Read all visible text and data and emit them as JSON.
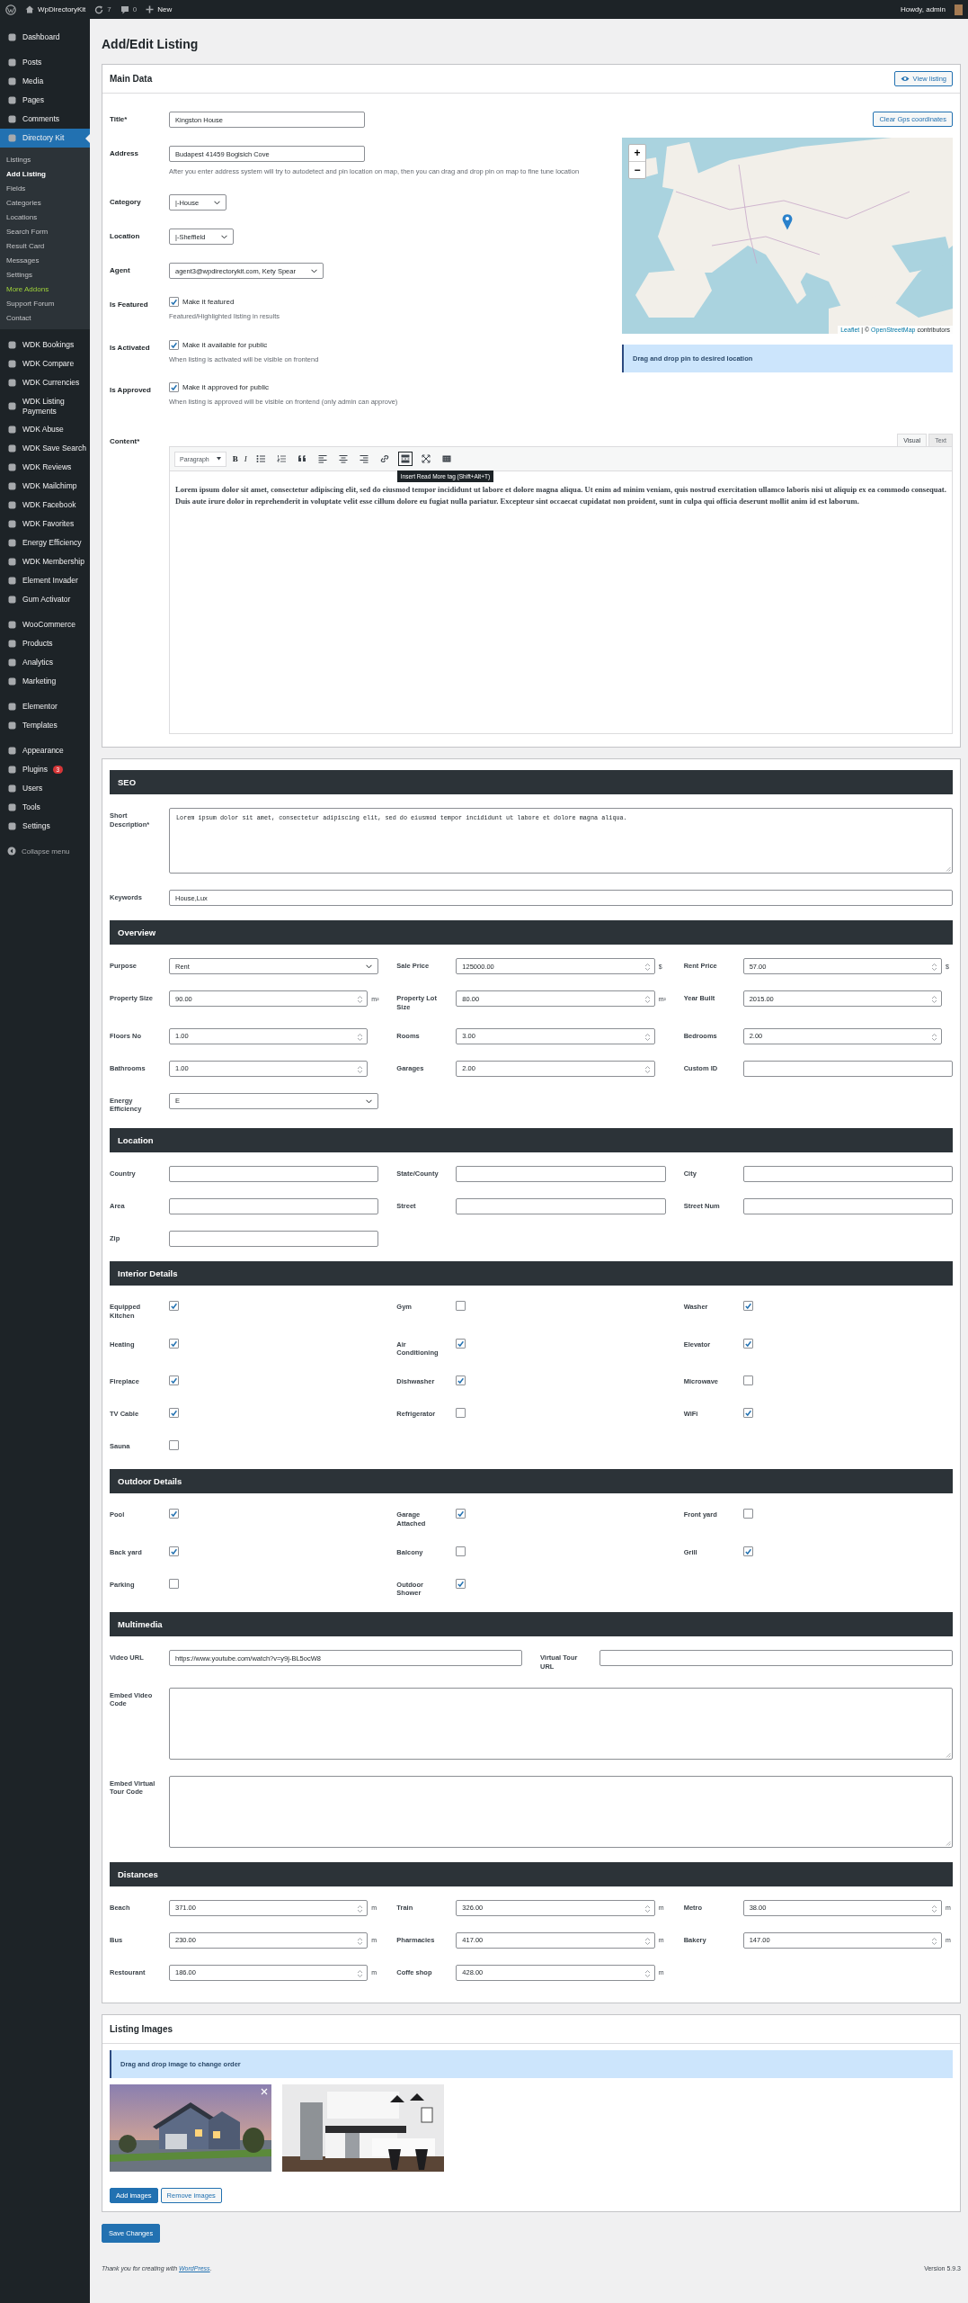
{
  "admin_bar": {
    "site": "WpDirectoryKit",
    "updates": "7",
    "comments": "0",
    "new": "New",
    "greeting": "Howdy, admin"
  },
  "sidebar": {
    "groups": [
      {
        "items": [
          {
            "label": "Dashboard",
            "selected": false
          }
        ]
      },
      {
        "items": [
          {
            "label": "Posts",
            "selected": false
          },
          {
            "label": "Media",
            "selected": false
          },
          {
            "label": "Pages",
            "selected": false
          },
          {
            "label": "Comments",
            "selected": false
          },
          {
            "label": "Directory Kit",
            "selected": true,
            "children": [
              {
                "label": "Listings",
                "selected": false,
                "highlighted": false
              },
              {
                "label": "Add Listing",
                "selected": true,
                "highlighted": false
              },
              {
                "label": "Fields",
                "selected": false,
                "highlighted": false
              },
              {
                "label": "Categories",
                "selected": false,
                "highlighted": false
              },
              {
                "label": "Locations",
                "selected": false,
                "highlighted": false
              },
              {
                "label": "Search Form",
                "selected": false,
                "highlighted": false
              },
              {
                "label": "Result Card",
                "selected": false,
                "highlighted": false
              },
              {
                "label": "Messages",
                "selected": false,
                "highlighted": false
              },
              {
                "label": "Settings",
                "selected": false,
                "highlighted": false
              },
              {
                "label": "More Addons",
                "selected": false,
                "highlighted": true
              },
              {
                "label": "Support Forum",
                "selected": false,
                "highlighted": false
              },
              {
                "label": "Contact",
                "selected": false,
                "highlighted": false
              }
            ]
          }
        ]
      },
      {
        "items": [
          {
            "label": "WDK Bookings",
            "selected": false
          },
          {
            "label": "WDK Compare",
            "selected": false
          },
          {
            "label": "WDK Currencies",
            "selected": false
          },
          {
            "label": "WDK Listing Payments",
            "selected": false
          },
          {
            "label": "WDK Abuse",
            "selected": false
          },
          {
            "label": "WDK Save Search",
            "selected": false
          },
          {
            "label": "WDK Reviews",
            "selected": false
          },
          {
            "label": "WDK Mailchimp",
            "selected": false
          },
          {
            "label": "WDK Facebook",
            "selected": false
          },
          {
            "label": "WDK Favorites",
            "selected": false
          },
          {
            "label": "Energy Efficiency",
            "selected": false
          },
          {
            "label": "WDK Membership",
            "selected": false
          },
          {
            "label": "Element Invader",
            "selected": false
          },
          {
            "label": "Gum Activator",
            "selected": false
          }
        ]
      },
      {
        "items": [
          {
            "label": "WooCommerce",
            "selected": false
          },
          {
            "label": "Products",
            "selected": false
          },
          {
            "label": "Analytics",
            "selected": false
          },
          {
            "label": "Marketing",
            "selected": false
          }
        ]
      },
      {
        "items": [
          {
            "label": "Elementor",
            "selected": false
          },
          {
            "label": "Templates",
            "selected": false
          }
        ]
      },
      {
        "items": [
          {
            "label": "Appearance",
            "selected": false
          },
          {
            "label": "Plugins",
            "selected": false,
            "badge": "3"
          },
          {
            "label": "Users",
            "selected": false
          },
          {
            "label": "Tools",
            "selected": false
          },
          {
            "label": "Settings",
            "selected": false
          }
        ]
      }
    ],
    "collapse_label": "Collapse menu"
  },
  "page_title": "Add/Edit Listing",
  "main_data": {
    "title": "Main Data",
    "view_button": "View listing",
    "clear_gps_button": "Clear Gps coordinates",
    "map": {
      "zoom_in": "+",
      "zoom_out": "−",
      "attribution": [
        {
          "kind": "link",
          "text": "Leaflet"
        },
        {
          "kind": "text",
          "text": " | © "
        },
        {
          "kind": "link",
          "text": "OpenStreetMap"
        },
        {
          "kind": "text",
          "text": " contributors"
        }
      ]
    },
    "map_notice": "Drag and drop pin to desired location",
    "fields": [
      {
        "label": "Title*",
        "kind": "text",
        "value": "Kingston House"
      },
      {
        "label": "Address",
        "kind": "text",
        "value": "Budapest 41459 Bogisich Cove",
        "help": "After you enter address system will try to autodetect and pin location on map, then you can drag and drop pin on map to fine tune location"
      },
      {
        "label": "Category",
        "kind": "select",
        "value": "|-House"
      },
      {
        "label": "Location",
        "kind": "select",
        "value": "|-Sheffield"
      },
      {
        "label": "Agent",
        "kind": "select",
        "value": "agent3@wpdirectorykit.com, Kety Spear"
      },
      {
        "label": "Is Featured",
        "kind": "checkbox",
        "checked": true,
        "option": "Make it featured",
        "help": "Featured/Highlighted listing in results"
      },
      {
        "label": "Is Activated",
        "kind": "checkbox",
        "checked": true,
        "option": "Make it available for public",
        "help": "When listing is activated will be visible on frontend"
      },
      {
        "label": "Is Approved",
        "kind": "checkbox",
        "checked": true,
        "option": "Make it approved for public",
        "help": "When listing is approved will be visible on frontend (only admin can approve)"
      }
    ],
    "content": {
      "label": "Content*",
      "tabs": [
        {
          "label": "Visual",
          "selected": true
        },
        {
          "label": "Text",
          "selected": false
        }
      ],
      "toolbar": [
        {
          "kind": "format",
          "label": "Paragraph",
          "active": false
        },
        {
          "kind": "bold",
          "label": "B",
          "active": false
        },
        {
          "kind": "italic",
          "label": "I",
          "active": false
        },
        {
          "kind": "bullet-list",
          "active": false
        },
        {
          "kind": "numbered-list",
          "active": false
        },
        {
          "kind": "quote",
          "active": false
        },
        {
          "kind": "align-left",
          "active": false
        },
        {
          "kind": "align-center",
          "active": false
        },
        {
          "kind": "align-right",
          "active": false
        },
        {
          "kind": "link",
          "active": false
        },
        {
          "kind": "read-more",
          "active": true
        },
        {
          "kind": "fullscreen",
          "active": false
        },
        {
          "kind": "toolbar-toggle",
          "active": false
        }
      ],
      "tooltip": "Insert Read More tag (Shift+Alt+T)",
      "text": "Lorem ipsum dolor sit amet, consectetur adipiscing elit, sed do eiusmod tempor incididunt ut labore et dolore magna aliqua. Ut enim ad minim veniam, quis nostrud exercitation ullamco laboris nisi ut aliquip ex ea commodo consequat. Duis aute irure dolor in reprehenderit in voluptate velit esse cillum dolore eu fugiat nulla pariatur. Excepteur sint occaecat cupidatat non proident, sunt in culpa qui officia deserunt mollit anim id est laborum."
    }
  },
  "sections": [
    {
      "title": "SEO",
      "groups": [
        {
          "kind": "full",
          "fields": [
            {
              "label": "Short Description*",
              "kind": "textarea",
              "mono": true,
              "value": "Lorem ipsum dolor sit amet, consectetur adipiscing elit, sed do eiusmod tempor incididunt ut labore et dolore magna aliqua."
            },
            {
              "label": "Keywords",
              "kind": "text",
              "value": "House,Lux"
            }
          ]
        }
      ]
    },
    {
      "title": "Overview",
      "groups": [
        {
          "kind": "grid3",
          "fields": [
            {
              "label": "Purpose",
              "kind": "select",
              "value": "Rent"
            },
            {
              "label": "Sale Price",
              "kind": "number",
              "value": "125000.00",
              "unit": "$"
            },
            {
              "label": "Rent Price",
              "kind": "number",
              "value": "57.00",
              "unit": "$"
            },
            {
              "label": "Property Size",
              "kind": "number",
              "value": "90.00",
              "unit": "m²"
            },
            {
              "label": "Property Lot Size",
              "kind": "number",
              "value": "80.00",
              "unit": "m²"
            },
            {
              "label": "Year Built",
              "kind": "number",
              "value": "2015.00"
            },
            {
              "label": "Floors No",
              "kind": "number",
              "value": "1.00"
            },
            {
              "label": "Rooms",
              "kind": "number",
              "value": "3.00"
            },
            {
              "label": "Bedrooms",
              "kind": "number",
              "value": "2.00"
            },
            {
              "label": "Bathrooms",
              "kind": "number",
              "value": "1.00"
            },
            {
              "label": "Garages",
              "kind": "number",
              "value": "2.00"
            },
            {
              "label": "Custom ID",
              "kind": "text"
            },
            {
              "label": "Energy Efficiency",
              "kind": "select",
              "value": "E"
            }
          ]
        }
      ]
    },
    {
      "title": "Location",
      "groups": [
        {
          "kind": "grid3",
          "fields": [
            {
              "label": "Country",
              "kind": "text"
            },
            {
              "label": "State/County",
              "kind": "text"
            },
            {
              "label": "City",
              "kind": "text"
            },
            {
              "label": "Area",
              "kind": "text"
            },
            {
              "label": "Street",
              "kind": "text"
            },
            {
              "label": "Street Num",
              "kind": "text"
            },
            {
              "label": "Zip",
              "kind": "text"
            }
          ]
        }
      ]
    },
    {
      "title": "Interior Details",
      "groups": [
        {
          "kind": "grid3",
          "fields": [
            {
              "label": "Equipped Kitchen",
              "kind": "checkbox",
              "checked": true
            },
            {
              "label": "Gym",
              "kind": "checkbox",
              "checked": false
            },
            {
              "label": "Washer",
              "kind": "checkbox",
              "checked": true
            },
            {
              "label": "Heating",
              "kind": "checkbox",
              "checked": true
            },
            {
              "label": "Air Conditioning",
              "kind": "checkbox",
              "checked": true
            },
            {
              "label": "Elevator",
              "kind": "checkbox",
              "checked": true
            },
            {
              "label": "Fireplace",
              "kind": "checkbox",
              "checked": true
            },
            {
              "label": "Dishwasher",
              "kind": "checkbox",
              "checked": true
            },
            {
              "label": "Microwave",
              "kind": "checkbox",
              "checked": false
            },
            {
              "label": "TV Cable",
              "kind": "checkbox",
              "checked": true
            },
            {
              "label": "Refrigerator",
              "kind": "checkbox",
              "checked": false
            },
            {
              "label": "WiFi",
              "kind": "checkbox",
              "checked": true
            },
            {
              "label": "Sauna",
              "kind": "checkbox",
              "checked": false
            }
          ]
        }
      ]
    },
    {
      "title": "Outdoor Details",
      "groups": [
        {
          "kind": "grid3",
          "fields": [
            {
              "label": "Pool",
              "kind": "checkbox",
              "checked": true
            },
            {
              "label": "Garage Attached",
              "kind": "checkbox",
              "checked": true
            },
            {
              "label": "Front yard",
              "kind": "checkbox",
              "checked": false
            },
            {
              "label": "Back yard",
              "kind": "checkbox",
              "checked": true
            },
            {
              "label": "Balcony",
              "kind": "checkbox",
              "checked": false
            },
            {
              "label": "Grill",
              "kind": "checkbox",
              "checked": true
            },
            {
              "label": "Parking",
              "kind": "checkbox",
              "checked": false
            },
            {
              "label": "Outdoor Shower",
              "kind": "checkbox",
              "checked": true
            }
          ]
        }
      ]
    },
    {
      "title": "Multimedia",
      "groups": [
        {
          "kind": "grid2",
          "fields": [
            {
              "label": "Video URL",
              "kind": "text",
              "value": "https://www.youtube.com/watch?v=y9j-BL5ocW8"
            },
            {
              "label": "Virtual Tour URL",
              "kind": "text"
            }
          ]
        },
        {
          "kind": "full",
          "fields": [
            {
              "label": "Embed Video Code",
              "kind": "textarea",
              "mono": false
            },
            {
              "label": "Embed Virtual Tour Code",
              "kind": "textarea",
              "mono": false
            }
          ]
        }
      ]
    },
    {
      "title": "Distances",
      "groups": [
        {
          "kind": "grid3",
          "fields": [
            {
              "label": "Beach",
              "kind": "number",
              "value": "371.00",
              "unit": "m"
            },
            {
              "label": "Train",
              "kind": "number",
              "value": "326.00",
              "unit": "m"
            },
            {
              "label": "Metro",
              "kind": "number",
              "value": "38.00",
              "unit": "m"
            },
            {
              "label": "Bus",
              "kind": "number",
              "value": "230.00",
              "unit": "m"
            },
            {
              "label": "Pharmacies",
              "kind": "number",
              "value": "417.00",
              "unit": "m"
            },
            {
              "label": "Bakery",
              "kind": "number",
              "value": "147.00",
              "unit": "m"
            },
            {
              "label": "Restourant",
              "kind": "number",
              "value": "186.00",
              "unit": "m"
            },
            {
              "label": "Coffe shop",
              "kind": "number",
              "value": "428.00",
              "unit": "m"
            }
          ]
        }
      ]
    }
  ],
  "listing_images": {
    "title": "Listing Images",
    "notice": "Drag and drop image to change order",
    "images": [
      {
        "kind": "picture",
        "show_remove": true
      },
      {
        "kind": "picture",
        "show_remove": false
      }
    ],
    "add_button": "Add images",
    "remove_button": "Remove images"
  },
  "save_button": "Save Changes",
  "footer": {
    "parts": [
      {
        "kind": "text",
        "text": "Thank you for creating with "
      },
      {
        "kind": "link",
        "text": "WordPress"
      },
      {
        "kind": "text",
        "text": "."
      }
    ],
    "version": "Version 5.9.3"
  }
}
